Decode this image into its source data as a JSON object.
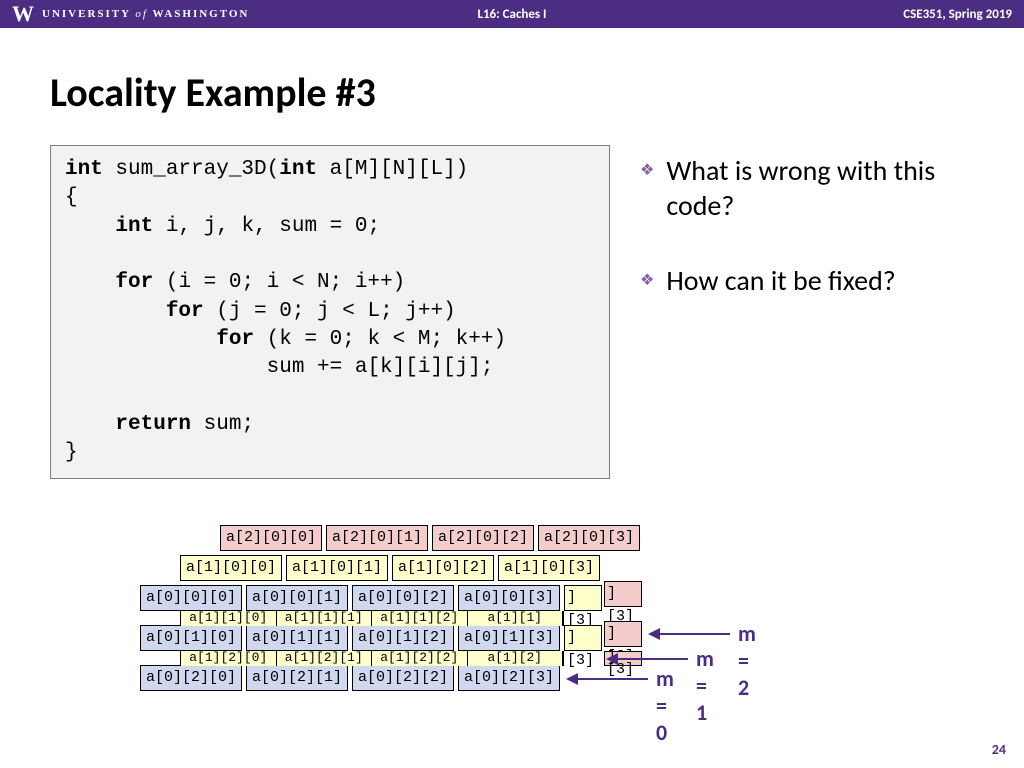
{
  "header": {
    "logo_letter": "W",
    "university": "UNIVERSITY",
    "of": "of",
    "washington": "WASHINGTON",
    "center": "L16:  Caches I",
    "right": "CSE351, Spring 2019"
  },
  "title": "Locality Example #3",
  "code": {
    "l1a": "int",
    "l1b": " sum_array_3D(",
    "l1c": "int",
    "l1d": " a[M][N][L])",
    "l2": "{",
    "l3a": "    ",
    "l3b": "int",
    "l3c": " i, j, k, sum = 0;",
    "blank1": "",
    "l4a": "    ",
    "l4b": "for",
    "l4c": " (i = 0; i < N; i++)",
    "l5a": "        ",
    "l5b": "for",
    "l5c": " (j = 0; j < L; j++)",
    "l6a": "            ",
    "l6b": "for",
    "l6c": " (k = 0; k < M; k++)",
    "l7": "                sum += a[k][i][j];",
    "blank2": "",
    "l8a": "    ",
    "l8b": "return",
    "l8c": " sum;",
    "l9": "}"
  },
  "questions": {
    "q1": "What is wrong with this code?",
    "q2": "How can it be fixed?"
  },
  "cells": {
    "r0c0": "a[2][0][0]",
    "r0c1": "a[2][0][1]",
    "r0c2": "a[2][0][2]",
    "r0c3": "a[2][0][3]",
    "r1c0": "a[1][0][0]",
    "r1c1": "a[1][0][1]",
    "r1c2": "a[1][0][2]",
    "r1c3": "a[1][0][3]",
    "r2c0": "a[0][0][0]",
    "r2c1": "a[0][0][1]",
    "r2c2": "a[0][0][2]",
    "r2c3": "a[0][0][3]",
    "r3c0": "a[0][1][0]",
    "r3c1": "a[0][1][1]",
    "r3c2": "a[0][1][2]",
    "r3c3": "a[0][1][3]",
    "r4c0": "a[0][2][0]",
    "r4c1": "a[0][2][1]",
    "r4c2": "a[0][2][2]",
    "r4c3": "a[0][2][3]",
    "t1": "][3]",
    "t2": "][3]",
    "t3": "][3]",
    "t4": "][3]",
    "t5": "][3]"
  },
  "labels": {
    "m2": "m =  2",
    "m1": "m = 1",
    "m0": "m = 0"
  },
  "page": "24"
}
